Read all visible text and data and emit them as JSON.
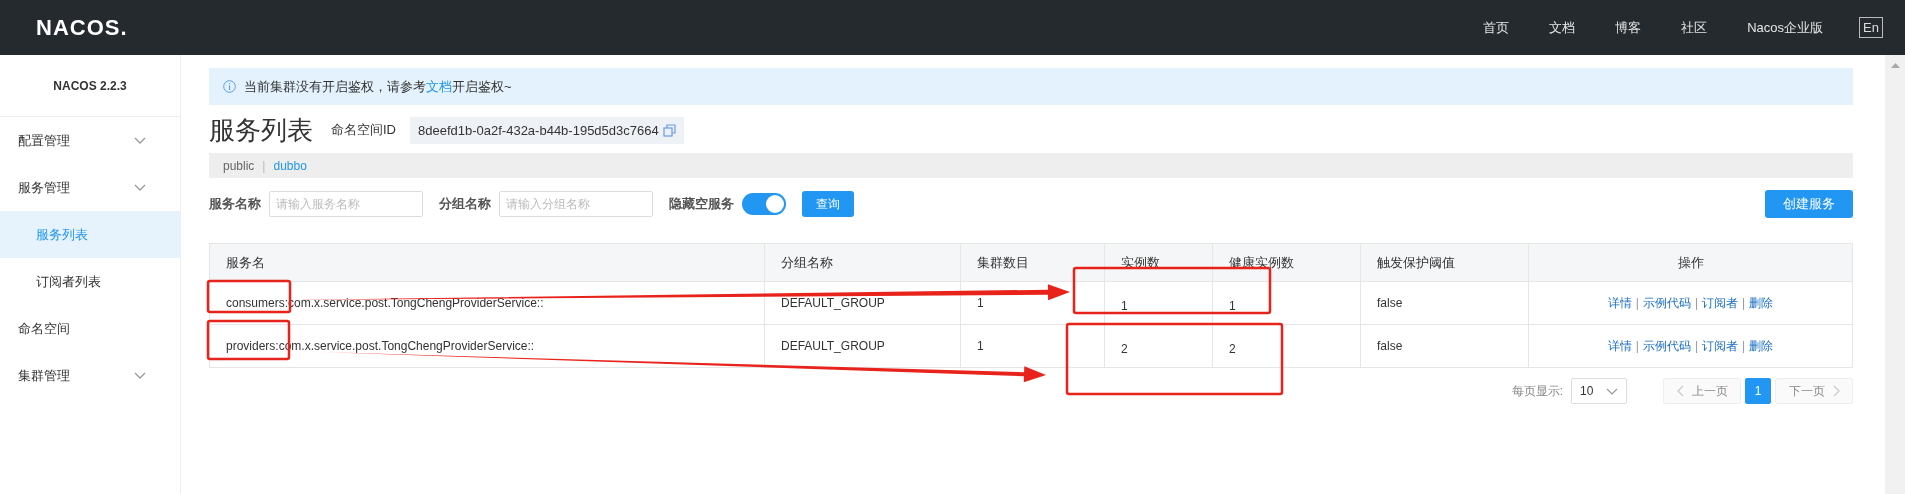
{
  "header": {
    "logo": "NACOS.",
    "nav": [
      "首页",
      "文档",
      "博客",
      "社区",
      "Nacos企业版"
    ],
    "lang_button": "En"
  },
  "sidebar": {
    "version": "NACOS 2.2.3",
    "items": [
      {
        "label": "配置管理",
        "kind": "group",
        "selected": false
      },
      {
        "label": "服务管理",
        "kind": "group",
        "selected": false,
        "children": [
          {
            "label": "服务列表",
            "selected": true
          },
          {
            "label": "订阅者列表",
            "selected": false
          }
        ]
      },
      {
        "label": "命名空间",
        "kind": "link",
        "selected": false
      },
      {
        "label": "集群管理",
        "kind": "group",
        "selected": false
      }
    ]
  },
  "notice": {
    "before": "当前集群没有开启鉴权，请参考",
    "link": "文档",
    "after": "开启鉴权~"
  },
  "page_title": "服务列表",
  "namespace_label": "命名空间ID",
  "namespace_id": "8deefd1b-0a2f-432a-b44b-195d5d3c7664",
  "namespaces": {
    "separator": "|",
    "items": [
      {
        "label": "public",
        "selected": false
      },
      {
        "label": "dubbo",
        "selected": true
      }
    ]
  },
  "filters": {
    "service_label": "服务名称",
    "service_placeholder": "请输入服务名称",
    "group_label": "分组名称",
    "group_placeholder": "请输入分组名称",
    "hide_empty_label": "隐藏空服务",
    "hide_empty_on": true,
    "query_button": "查询",
    "create_button": "创建服务"
  },
  "table": {
    "columns": [
      "服务名",
      "分组名称",
      "集群数目",
      "实例数",
      "健康实例数",
      "触发保护阈值",
      "操作"
    ],
    "ops_separator": "|",
    "rows": [
      {
        "cells": [
          "consumers:com.x.service.post.TongChengProviderService::",
          "DEFAULT_GROUP",
          "1",
          "1",
          "1",
          "false"
        ],
        "ops": [
          "详情",
          "示例代码",
          "订阅者",
          "删除"
        ]
      },
      {
        "cells": [
          "providers:com.x.service.post.TongChengProviderService::",
          "DEFAULT_GROUP",
          "1",
          "2",
          "2",
          "false"
        ],
        "ops": [
          "详情",
          "示例代码",
          "订阅者",
          "删除"
        ]
      }
    ]
  },
  "pagination": {
    "page_size_label": "每页显示:",
    "page_size": "10",
    "prev": "上一页",
    "prev_disabled": true,
    "pages": [
      {
        "label": "1",
        "selected": true
      }
    ],
    "next": "下一页",
    "next_disabled": true
  },
  "annotations": [
    {
      "kind": "box"
    },
    {
      "kind": "box"
    },
    {
      "kind": "arrow"
    },
    {
      "kind": "box"
    },
    {
      "kind": "box"
    },
    {
      "kind": "arrow"
    }
  ]
}
